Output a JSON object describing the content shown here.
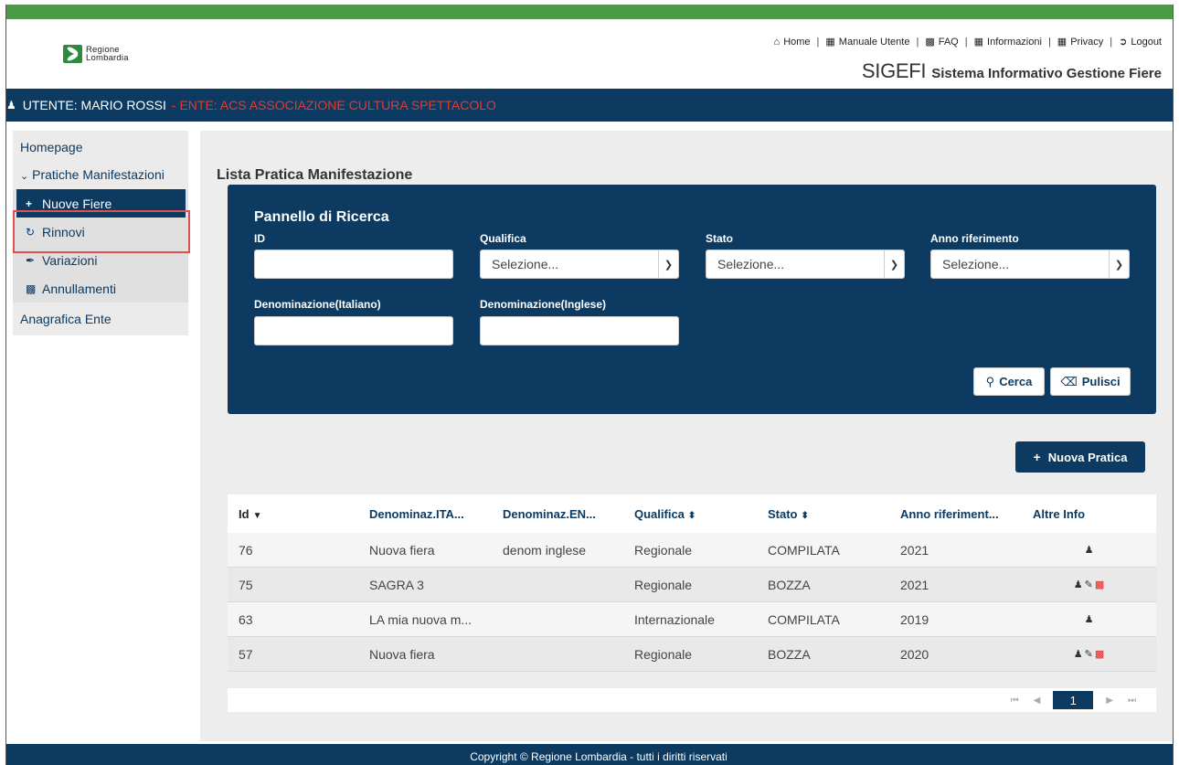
{
  "colors": {
    "topbar": "#4c9a45",
    "navy": "#0c3a61",
    "ente_red": "#e23b2e",
    "highlight": "#e05050"
  },
  "logo": {
    "line1": "Regione",
    "line2": "Lombardia"
  },
  "top_links": [
    {
      "icon": "home-icon",
      "label": "Home"
    },
    {
      "icon": "document-icon",
      "label": "Manuale Utente"
    },
    {
      "icon": "faq-icon",
      "label": "FAQ"
    },
    {
      "icon": "document-icon",
      "label": "Informazioni"
    },
    {
      "icon": "document-icon",
      "label": "Privacy"
    },
    {
      "icon": "logout-icon",
      "label": "Logout"
    }
  ],
  "brand": {
    "name": "SIGEFI",
    "subtitle": "Sistema Informativo Gestione Fiere"
  },
  "userbar": {
    "user": "UTENTE: MARIO ROSSI",
    "ente": "- ENTE: ACS ASSOCIAZIONE CULTURA SPETTACOLO"
  },
  "sidebar": {
    "homepage": "Homepage",
    "group_label": "Pratiche Manifestazioni",
    "items": [
      {
        "icon": "plus-icon",
        "label": "Nuove Fiere"
      },
      {
        "icon": "refresh-icon",
        "label": "Rinnovi"
      },
      {
        "icon": "pencil-icon",
        "label": "Variazioni"
      },
      {
        "icon": "trash-icon",
        "label": "Annullamenti"
      }
    ],
    "anagrafica": "Anagrafica Ente"
  },
  "page_title": "Lista Pratica Manifestazione",
  "search": {
    "title": "Pannello di Ricerca",
    "id_label": "ID",
    "qualifica_label": "Qualifica",
    "qualifica_value": "Selezione...",
    "stato_label": "Stato",
    "stato_value": "Selezione...",
    "anno_label": "Anno riferimento",
    "anno_value": "Selezione...",
    "den_it_label": "Denominazione(Italiano)",
    "den_en_label": "Denominazione(Inglese)",
    "cerca": "Cerca",
    "pulisci": "Pulisci"
  },
  "new_button": "Nuova Pratica",
  "table": {
    "headers": [
      "Id",
      "Denominaz.ITA...",
      "Denominaz.EN...",
      "Qualifica",
      "Stato",
      "Anno riferiment...",
      "Altre Info"
    ],
    "rows": [
      {
        "id": "76",
        "ita": "Nuova fiera",
        "en": "denom inglese",
        "qualifica": "Regionale",
        "stato": "COMPILATA",
        "anno": "2021",
        "actions": [
          "user-icon"
        ]
      },
      {
        "id": "75",
        "ita": "SAGRA 3",
        "en": "",
        "qualifica": "Regionale",
        "stato": "BOZZA",
        "anno": "2021",
        "actions": [
          "user-icon",
          "edit-icon",
          "trash-icon"
        ]
      },
      {
        "id": "63",
        "ita": "LA mia nuova m...",
        "en": "",
        "qualifica": "Internazionale",
        "stato": "COMPILATA",
        "anno": "2019",
        "actions": [
          "user-icon"
        ]
      },
      {
        "id": "57",
        "ita": "Nuova fiera",
        "en": "",
        "qualifica": "Regionale",
        "stato": "BOZZA",
        "anno": "2020",
        "actions": [
          "user-icon",
          "edit-icon",
          "trash-icon"
        ]
      }
    ]
  },
  "pager": {
    "current": "1"
  },
  "footer": "Copyright © Regione Lombardia - tutti i diritti riservati"
}
